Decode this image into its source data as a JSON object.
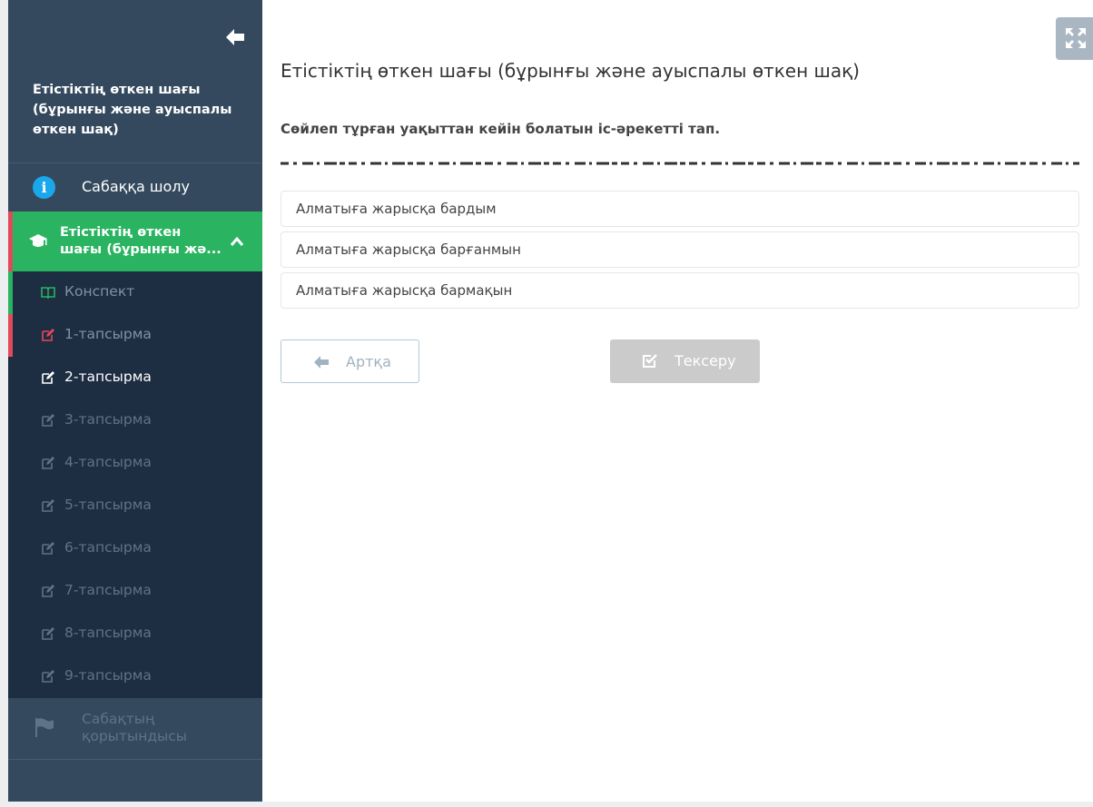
{
  "sidebar": {
    "course_title": "Етістіктің өткен шағы (бұрынғы және ауыспалы өткен шақ)",
    "overview_label": "Сабаққа шолу",
    "lesson_label": "Етістіктің өткен шағы (бұрынғы жә...",
    "items": [
      {
        "label": "Конспект",
        "icon": "book-icon"
      },
      {
        "label": "1-тапсырма",
        "icon": "edit-icon"
      },
      {
        "label": "2-тапсырма",
        "icon": "edit-icon"
      },
      {
        "label": "3-тапсырма",
        "icon": "edit-icon"
      },
      {
        "label": "4-тапсырма",
        "icon": "edit-icon"
      },
      {
        "label": "5-тапсырма",
        "icon": "edit-icon"
      },
      {
        "label": "6-тапсырма",
        "icon": "edit-icon"
      },
      {
        "label": "7-тапсырма",
        "icon": "edit-icon"
      },
      {
        "label": "8-тапсырма",
        "icon": "edit-icon"
      },
      {
        "label": "9-тапсырма",
        "icon": "edit-icon"
      }
    ],
    "conclusion_label": "Сабақтың қорытындысы"
  },
  "main": {
    "title": "Етістіктің өткен шағы (бұрынғы және ауыспалы өткен шақ)",
    "question": "Сөйлеп тұрған уақыттан кейін болатын іс-әрекетті тап.",
    "options": [
      "Алматыға жарысқа бардым",
      "Алматыға жарысқа барғанмын",
      "Алматыға жарысқа бармақын"
    ],
    "back_button": "Артқа",
    "check_button": "Тексеру"
  },
  "colors": {
    "sidebar_bg": "#34495e",
    "sublist_bg": "#1d2d42",
    "active_lesson": "#2ab461",
    "accent_red": "#e14a5a",
    "info_blue": "#1aa7ec"
  }
}
